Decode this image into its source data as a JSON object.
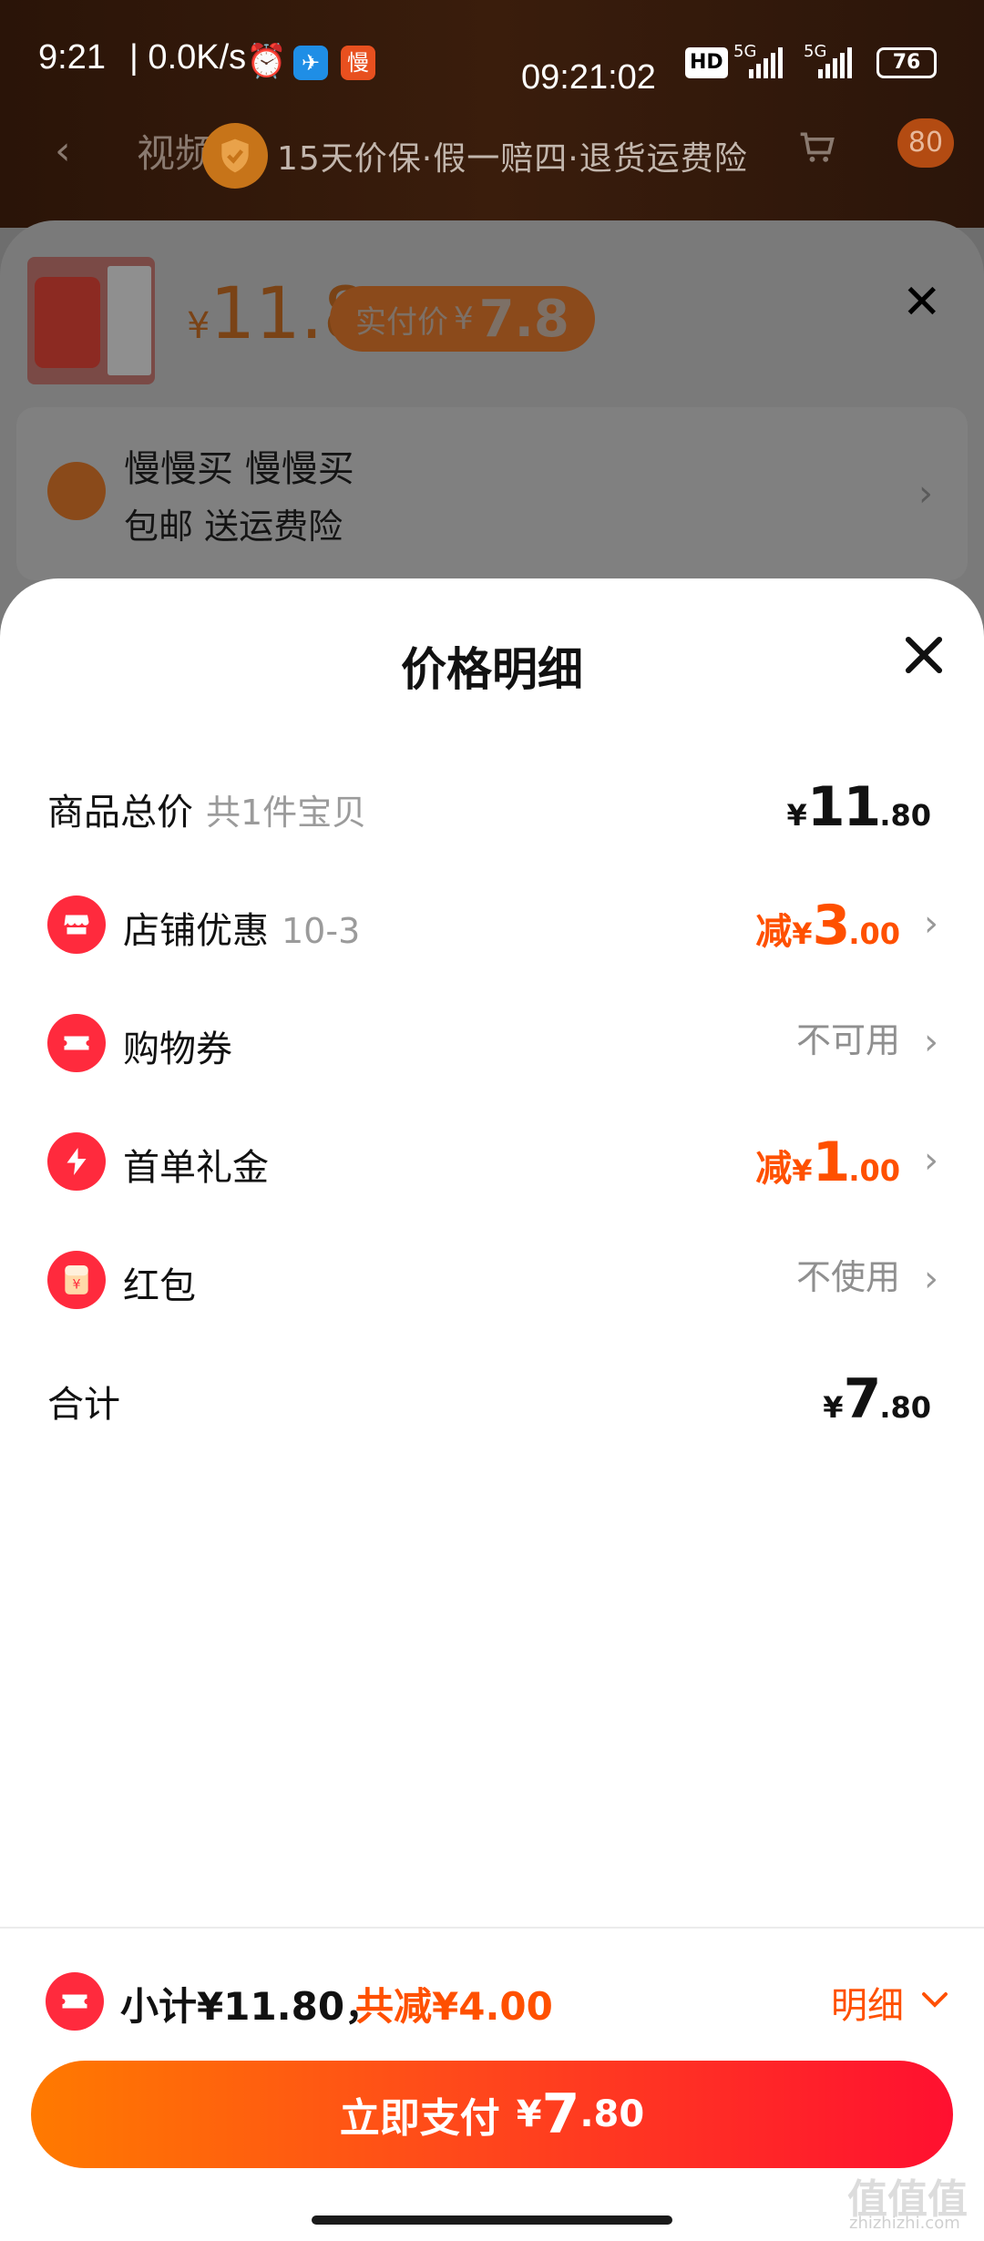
{
  "status_bar": {
    "time": "9:21",
    "network_speed": "| 0.0K/s",
    "center_clock": "09:21:02",
    "hd_badge": "HD",
    "signal1": "5G",
    "signal2": "5G",
    "battery": "76",
    "app_icon_1": "feishu-icon",
    "app_icon_2_label": "慢"
  },
  "background_page": {
    "nav_title": "视频",
    "guarantee_text": "15天价保·假一赔四·退货运费险",
    "cart_badge": "80"
  },
  "product_sheet": {
    "price_yen": "¥",
    "price": "11.8",
    "paid_label": "实付价",
    "paid_yen": "¥",
    "paid_amount": "7.8",
    "address_line1": "慢慢买 慢慢买",
    "address_line2": "包邮 送运费险"
  },
  "price_detail": {
    "title": "价格明细",
    "rows": [
      {
        "label": "商品总价",
        "sub": "共1件宝贝",
        "value_prefix": "",
        "value_yen": "¥",
        "value_big": "11",
        "value_dec": ".80"
      },
      {
        "label": "店铺优惠",
        "sub": "10-3",
        "value_prefix": "减",
        "value_yen": "¥",
        "value_big": "3",
        "value_dec": ".00",
        "icon": "store-icon"
      },
      {
        "label": "购物券",
        "value_text": "不可用",
        "icon": "ticket-icon"
      },
      {
        "label": "首单礼金",
        "value_prefix": "减",
        "value_yen": "¥",
        "value_big": "1",
        "value_dec": ".00",
        "icon": "lightning-icon"
      },
      {
        "label": "红包",
        "value_text": "不使用",
        "icon": "red-envelope-icon"
      },
      {
        "label": "合计",
        "value_yen": "¥",
        "value_big": "7",
        "value_dec": ".80"
      }
    ]
  },
  "footer": {
    "subtotal": "小计¥11.80，",
    "discount": "共减¥4.00",
    "detail_label": "明细",
    "pay_label": "立即支付",
    "pay_yen": "¥",
    "pay_big": "7",
    "pay_dec": ".80"
  },
  "watermark": {
    "text": "值值值",
    "sub": "zhizhizhi.com"
  },
  "colors": {
    "accent": "#ff5000",
    "brand_red": "#ff2a3d",
    "pay_gradient_start": "#ff7a00",
    "pay_gradient_end": "#ff1030"
  }
}
